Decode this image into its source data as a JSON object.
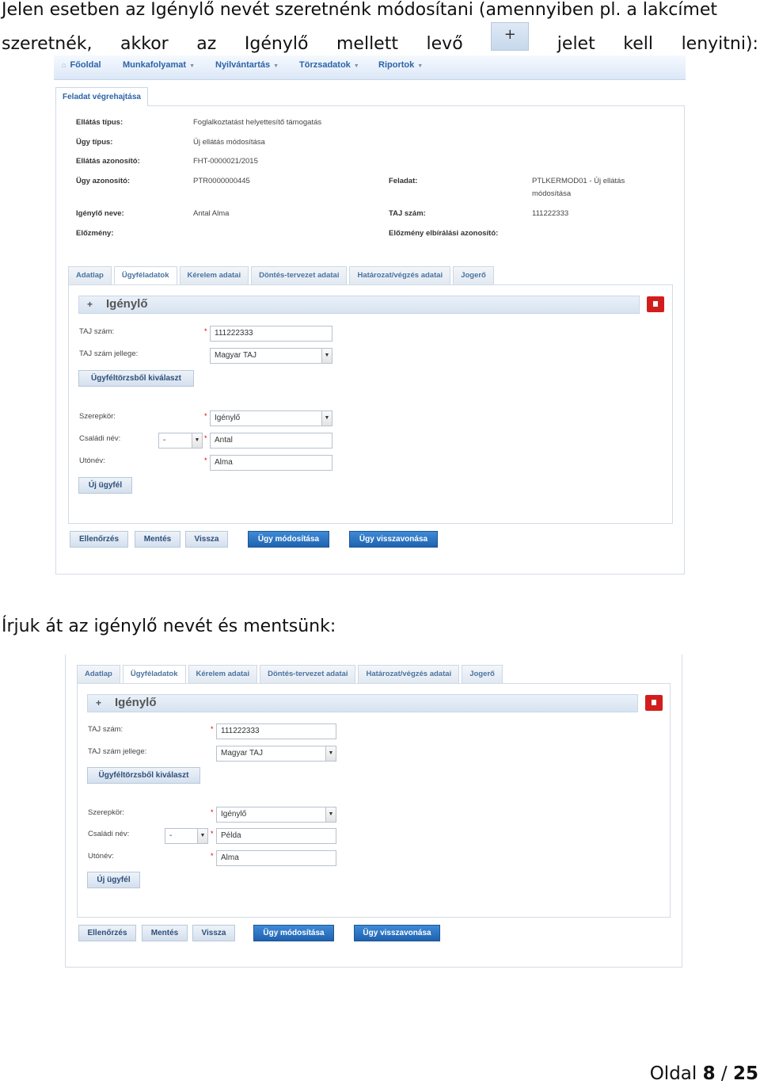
{
  "intro": {
    "line1": "Jelen esetben az Igénylő nevét szeretnénk módosítani (amennyiben pl. a lakcímet",
    "line2_words": [
      "szeretnék,",
      "akkor",
      "az",
      "Igénylő",
      "mellett",
      "levő"
    ],
    "plus_symbol": "+",
    "line2_tail": [
      "jelet",
      "kell",
      "lenyitni):"
    ]
  },
  "nav": {
    "items": [
      "Főoldal",
      "Munkafolyamat",
      "Nyilvántartás",
      "Törzsadatok",
      "Riportok"
    ]
  },
  "task_tab": "Feladat végrehajtása",
  "details": {
    "ellatas_tipus_label": "Ellátás típus:",
    "ellatas_tipus_value": "Foglalkoztatást helyettesítő támogatás",
    "ugy_tipus_label": "Ügy típus:",
    "ugy_tipus_value": "Új ellátás módosítása",
    "ellatas_azon_label": "Ellátás azonosító:",
    "ellatas_azon_value": "FHT-0000021/2015",
    "ugy_azon_label": "Ügy azonosító:",
    "ugy_azon_value": "PTR0000000445",
    "feladat_label": "Feladat:",
    "feladat_value_1": "PTLKERMOD01 - Új ellátás",
    "feladat_value_2": "módosítása",
    "igenylo_neve_label": "Igénylő neve:",
    "igenylo_neve_value": "Antal Alma",
    "taj_label": "TAJ szám:",
    "taj_value": "111222333",
    "elozmeny_label": "Előzmény:",
    "elozmeny_azon_label": "Előzmény elbírálási azonosító:"
  },
  "tabs": [
    "Adatlap",
    "Ügyféladatok",
    "Kérelem adatai",
    "Döntés-tervezet adatai",
    "Határozat/végzés adatai",
    "Jogerő"
  ],
  "section": {
    "plus": "+",
    "title": "Igénylő",
    "taj_label": "TAJ szám:",
    "taj_value": "111222333",
    "taj_type_label": "TAJ szám jellege:",
    "taj_type_value": "Magyar TAJ",
    "select_button": "Ügyféltörzsből kiválaszt",
    "role_label": "Szerepkör:",
    "role_value": "Igénylő",
    "family_label": "Családi név:",
    "prefix_value": "-",
    "given_label": "Utónév:",
    "given_value": "Alma",
    "new_client_button": "Új ügyfél",
    "star": "*",
    "arrow": "▼"
  },
  "screen1": {
    "family_value": "Antal"
  },
  "screen2": {
    "family_value": "Példa"
  },
  "actions": [
    "Ellenőrzés",
    "Mentés",
    "Vissza",
    "Ügy módosítása",
    "Ügy visszavonása"
  ],
  "middle_text": "Írjuk át az igénylő nevét és mentsünk:",
  "footer": {
    "prefix": "Oldal",
    "page": "8",
    "sep": "/",
    "total": "25"
  }
}
